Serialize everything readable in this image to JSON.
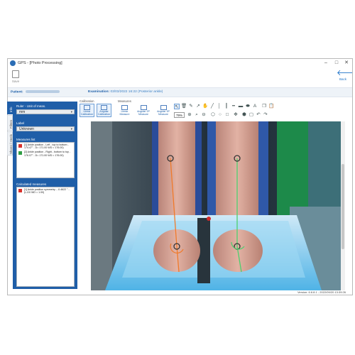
{
  "window": {
    "title": "GPS - [Photo Processing]"
  },
  "toolbar": {
    "save_label": "Save",
    "back_label": "Back"
  },
  "info": {
    "patient_label": "Patient:",
    "examination_label": "Examination:",
    "examination_value": "03/03/2022 16:22 (Posterior ankle)"
  },
  "vtabs": [
    "Info",
    "Filters",
    "Shoes / Heels"
  ],
  "side_panel": {
    "ruler_label": "Ruler - Unit of meas.",
    "ruler_value": "mm",
    "label_label": "Label",
    "label_value": "Unknown",
    "measures_list_label": "Measures list",
    "measures": [
      {
        "text": "[1] Ankle position - Left - top to bottom - 174.47° - D= 171.00 WD = 176.00)",
        "color": "#d9312b"
      },
      {
        "text": "[2] Ankle position - Right - bottom to top - 176.07° - D= 171.00 WD = 176.00)",
        "color": "#2f9e44"
      }
    ],
    "calculated_label": "Calculated measures",
    "calculated": [
      {
        "text": "[1] Ankle position symmetry - -0.4622 ° - (L-D0 WD = 1.00)",
        "color": "#d9312b"
      }
    ]
  },
  "ribbon": {
    "calibration_label": "Calibration",
    "measures_label": "Measures",
    "buttons": [
      {
        "label": "Linear Calibration",
        "active": true
      },
      {
        "label": "Angular Calibration",
        "active": true
      },
      {
        "label": "Linear Measure",
        "active": false
      },
      {
        "label": "Angular 2P Measure",
        "active": false
      },
      {
        "label": "Angular 3P Measure",
        "active": false
      }
    ],
    "zoom_value": "79%"
  },
  "status": {
    "text": "Version: 6.6.8.1 - 2022/09/20 13:39:26"
  },
  "colors": {
    "accent": "#1f5ea8",
    "left_line": "#f07a2a",
    "right_line": "#4ccf6e"
  }
}
